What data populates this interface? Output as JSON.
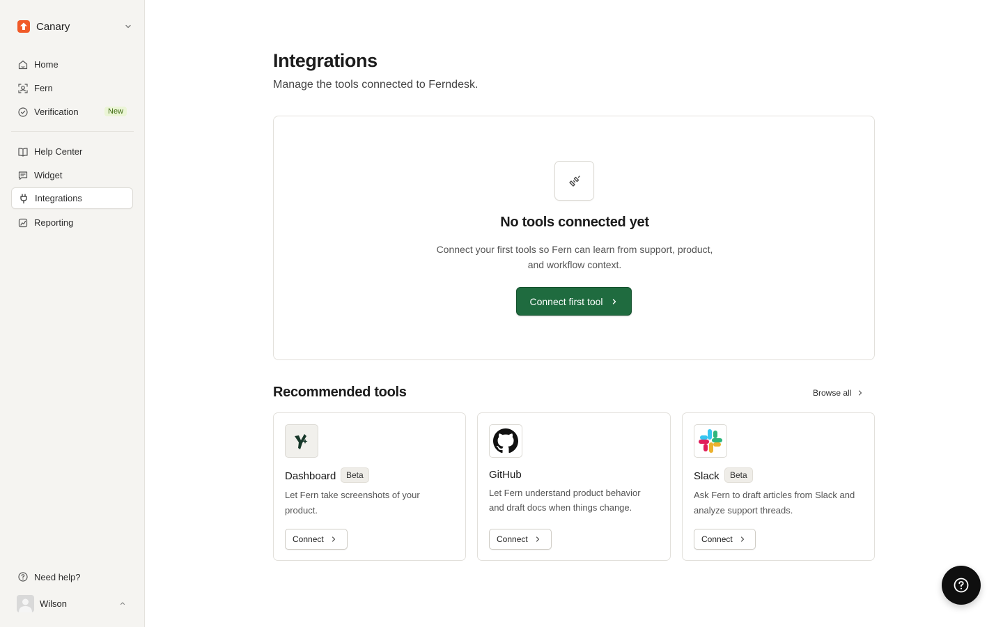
{
  "sidebar": {
    "workspace": {
      "name": "Canary",
      "logo_icon": "canary-logo-icon",
      "accent": "#f05a28"
    },
    "nav": [
      {
        "label": "Home",
        "icon": "home-icon"
      },
      {
        "label": "Fern",
        "icon": "fern-icon"
      },
      {
        "label": "Verification",
        "icon": "check-circle-icon",
        "badge": "New"
      },
      {
        "label": "Help Center",
        "icon": "book-icon"
      },
      {
        "label": "Widget",
        "icon": "chat-icon"
      },
      {
        "label": "Integrations",
        "icon": "plug-icon",
        "active": true
      },
      {
        "label": "Reporting",
        "icon": "chart-icon"
      }
    ],
    "help_label": "Need help?",
    "user": {
      "name": "Wilson"
    }
  },
  "main": {
    "title": "Integrations",
    "subtitle": "Manage the tools connected to Ferndesk.",
    "empty_state": {
      "title": "No tools connected yet",
      "description": "Connect your first tools so Fern can learn from support, product, and workflow context.",
      "button_label": "Connect first tool"
    },
    "recommended": {
      "title": "Recommended tools",
      "browse_label": "Browse all",
      "tools": [
        {
          "name": "Dashboard",
          "badge": "Beta",
          "description": "Let Fern take screenshots of your product.",
          "button_label": "Connect",
          "icon": "dashboard-logo-icon"
        },
        {
          "name": "GitHub",
          "badge": "",
          "description": "Let Fern understand product behavior and draft docs when things change.",
          "button_label": "Connect",
          "icon": "github-logo-icon"
        },
        {
          "name": "Slack",
          "badge": "Beta",
          "description": "Ask Fern to draft articles from Slack and analyze support threads.",
          "button_label": "Connect",
          "icon": "slack-logo-icon"
        }
      ]
    }
  },
  "colors": {
    "primary_button": "#1f6b3f",
    "sidebar_bg": "#f5f4f1",
    "badge_new_bg": "#ebf5d6",
    "badge_new_text": "#3f6b12"
  }
}
